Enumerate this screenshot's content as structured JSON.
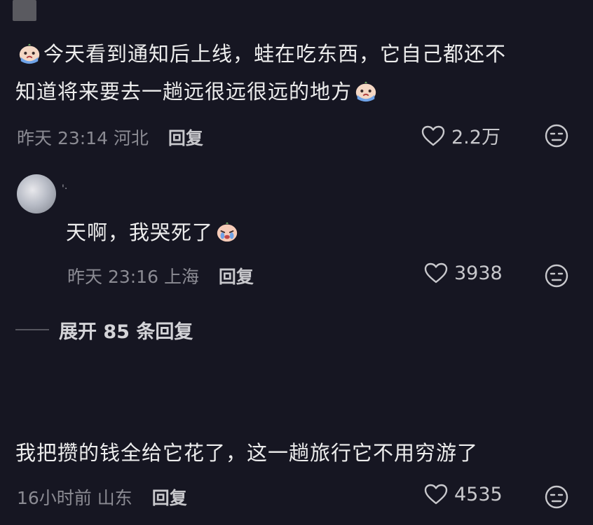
{
  "comments": [
    {
      "text_part1": "今天看到通知后上线，蛙在吃东西，它自己都还不",
      "text_part2": "知道将来要去一趟远很远很远的地方",
      "time": "昨天 23:14",
      "location": "河北",
      "reply_label": "回复",
      "likes": "2.2万"
    },
    {
      "text": "天啊，我哭死了",
      "time": "昨天 23:16",
      "location": "上海",
      "reply_label": "回复",
      "likes": "3938"
    },
    {
      "text": "我把攒的钱全给它花了，这一趟旅行它不用穷游了",
      "time": "16小时前",
      "location": "山东",
      "reply_label": "回复",
      "likes": "4535"
    }
  ],
  "expand_replies": "展开 85 条回复",
  "reply_author": "'·",
  "colors": {
    "background": "#161622",
    "text": "#ededed",
    "meta": "#8b8b93"
  },
  "icons": [
    "crying-emoji-icon",
    "heart-icon",
    "dislike-face-icon"
  ]
}
